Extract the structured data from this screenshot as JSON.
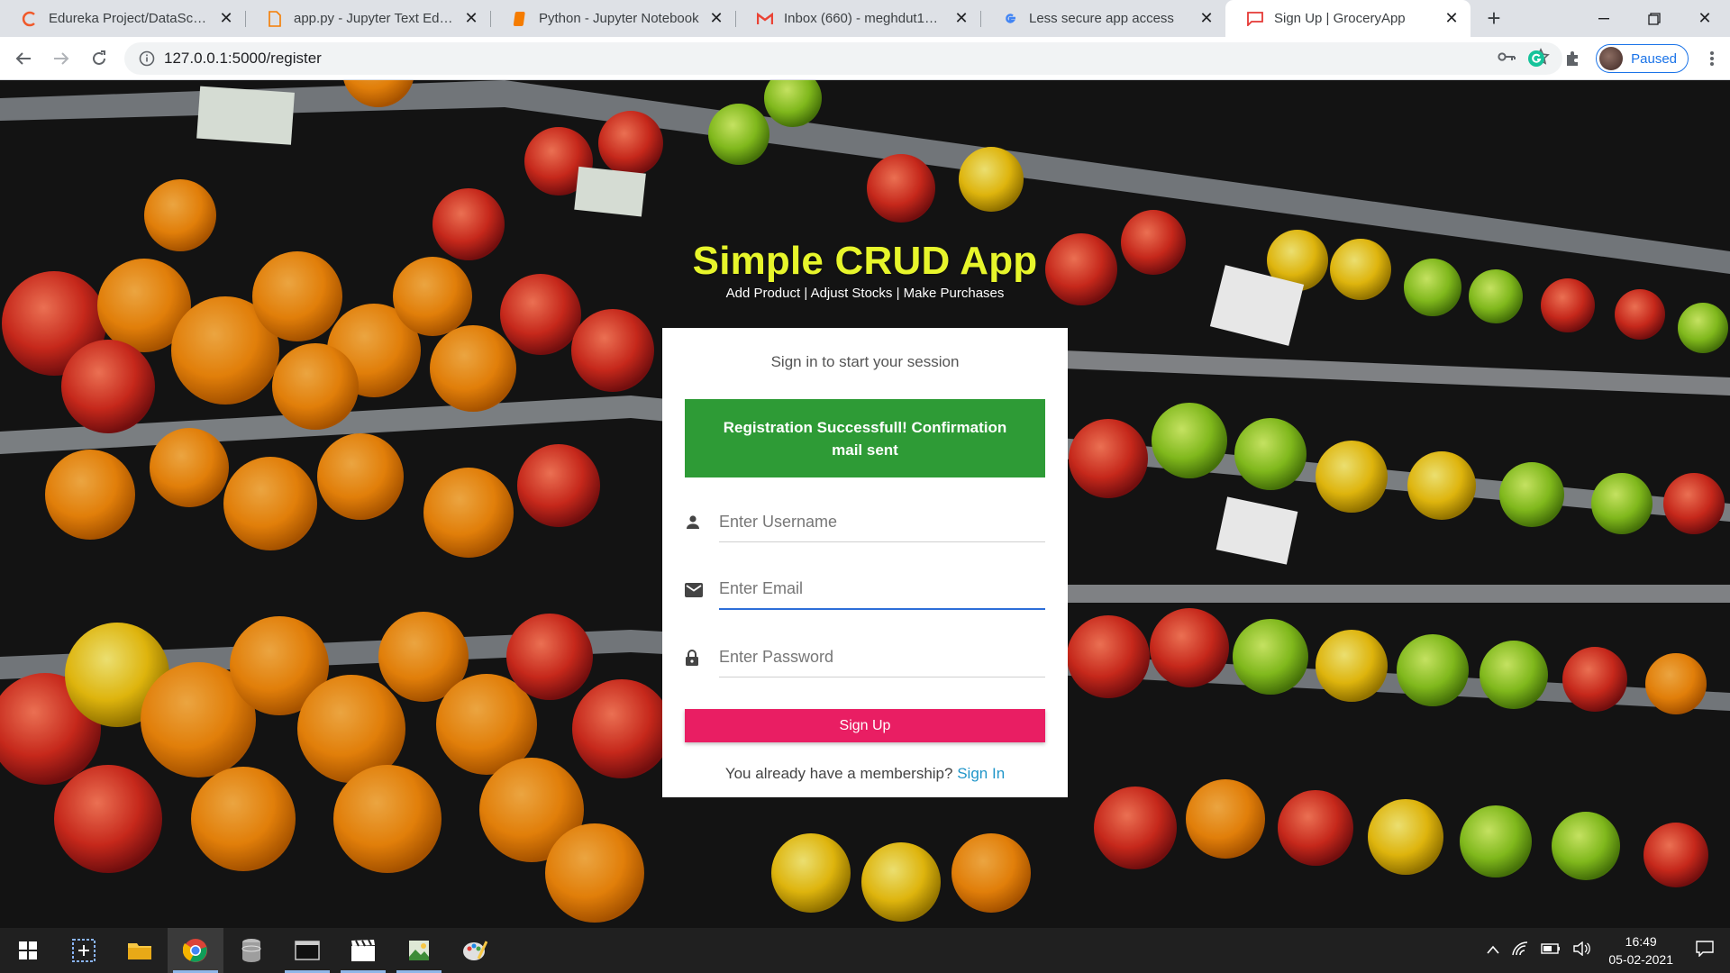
{
  "browser": {
    "tabs": [
      {
        "title": "Edureka Project/DataSceicne",
        "icon": "edureka-icon"
      },
      {
        "title": "app.py - Jupyter Text Editor",
        "icon": "file-icon"
      },
      {
        "title": "Python - Jupyter Notebook",
        "icon": "notebook-icon"
      },
      {
        "title": "Inbox (660) - meghdut1996@",
        "icon": "gmail-icon"
      },
      {
        "title": "Less secure app access",
        "icon": "google-icon"
      },
      {
        "title": "Sign Up | GroceryApp",
        "icon": "page-icon",
        "active": true
      }
    ],
    "url": "127.0.0.1:5000/register",
    "profile_status": "Paused"
  },
  "app": {
    "title": "Simple CRUD App",
    "subtitle": "Add Product | Adjust Stocks | Make Purchases",
    "session_msg": "Sign in to start your session",
    "alert": "Registration Successfull! Confirmation mail sent",
    "fields": {
      "username_placeholder": "Enter Username",
      "email_placeholder": "Enter Email",
      "password_placeholder": "Enter Password"
    },
    "submit_label": "Sign Up",
    "membership_text": "You already have a membership?",
    "signin_link": "Sign In"
  },
  "taskbar": {
    "time": "16:49",
    "date": "05-02-2021"
  },
  "colors": {
    "brand_title": "#e7f52b",
    "alert_bg": "#2e9b36",
    "button_bg": "#e91e63",
    "link": "#2196c9",
    "focus": "#2d6ed8"
  }
}
